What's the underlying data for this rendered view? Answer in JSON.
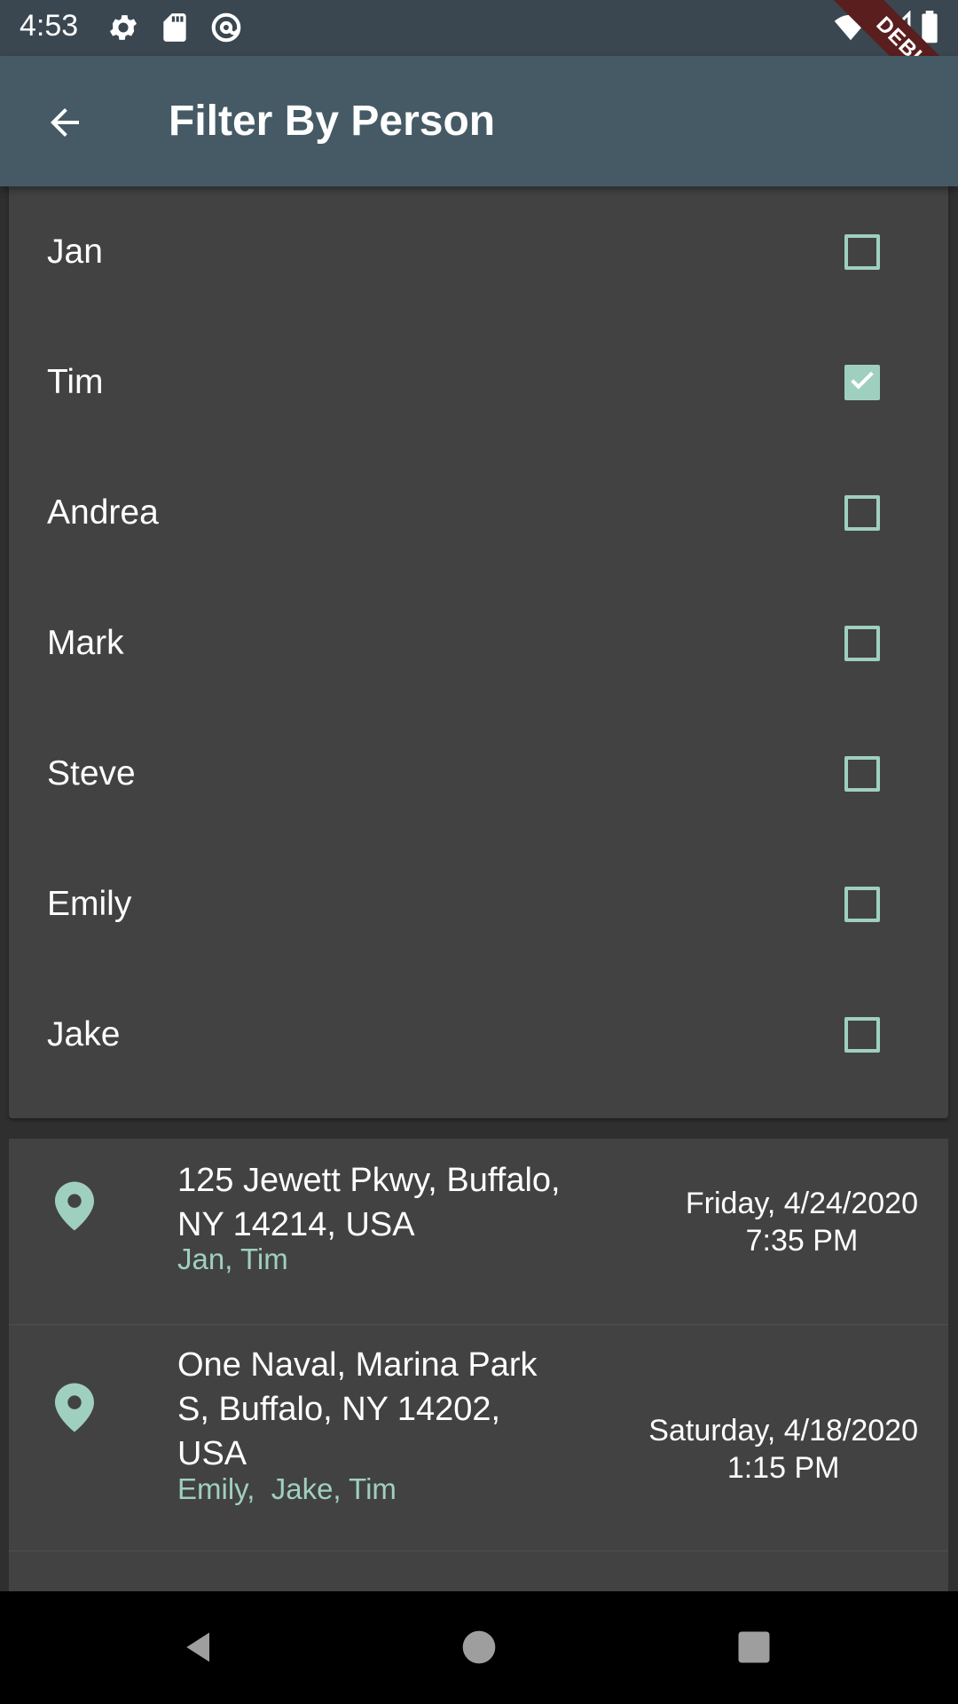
{
  "status_bar": {
    "time": "4:53",
    "icons": [
      "gear-icon",
      "sd-card-icon",
      "at-sign-icon",
      "wifi-icon",
      "signal-icon",
      "battery-icon"
    ],
    "debug_label": "DEBUG"
  },
  "app_bar": {
    "title": "Filter By Person",
    "back_icon": "arrow-back-icon",
    "color": "#455a64"
  },
  "people_filter": [
    {
      "name": "Jan",
      "checked": false
    },
    {
      "name": "Tim",
      "checked": true
    },
    {
      "name": "Andrea",
      "checked": false
    },
    {
      "name": "Mark",
      "checked": false
    },
    {
      "name": "Steve",
      "checked": false
    },
    {
      "name": "Emily",
      "checked": false
    },
    {
      "name": "Jake",
      "checked": false
    }
  ],
  "locations": [
    {
      "address": "125 Jewett Pkwy, Buffalo, NY 14214, USA",
      "people": "Jan, Tim",
      "date": "Friday, 4/24/2020",
      "time": "7:35 PM"
    },
    {
      "address": "One Naval, Marina Park S, Buffalo, NY 14202, USA",
      "people": "Emily,  Jake, Tim",
      "date": "Saturday, 4/18/2020",
      "time": "1:15 PM"
    }
  ],
  "colors": {
    "accent": "#9fcfbf",
    "card": "#424242",
    "background": "#2f2f2f"
  },
  "nav_bar": {
    "icons": [
      "back-triangle-icon",
      "home-circle-icon",
      "recents-square-icon"
    ]
  }
}
